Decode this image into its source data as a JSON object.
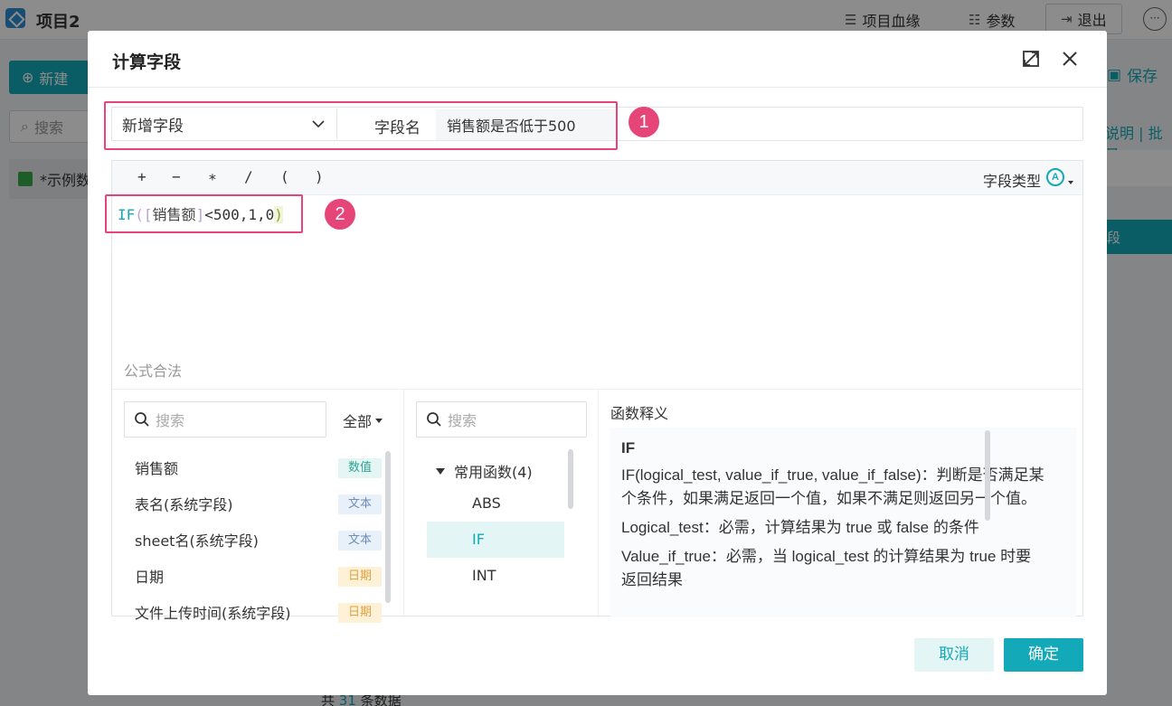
{
  "app": {
    "title": "项目2",
    "header": {
      "lineage": "项目血缘",
      "params": "参数",
      "exit": "退出",
      "more": "···"
    },
    "new_button": "新建",
    "search_placeholder": "搜索",
    "tree_item": "*示例数",
    "save": "保存",
    "desc_links": "说明 | 批量",
    "teal_item": "段",
    "footer": {
      "prefix": "共",
      "count": "31",
      "suffix": "条数据"
    }
  },
  "dialog": {
    "title": "计算字段",
    "mode_select": "新增字段",
    "field_name_label": "字段名",
    "field_name_value": "销售额是否低于500",
    "annotation_1": "1",
    "annotation_2": "2",
    "operators": [
      "+",
      "−",
      "∗",
      "/",
      "(",
      ")"
    ],
    "field_type_label": "字段类型",
    "field_type_icon": "A",
    "formula": {
      "fn": "IF",
      "open": "(",
      "field_open": "[",
      "field": "销售额",
      "field_close": "]",
      "rest": "<500,1,0",
      "close": ")"
    },
    "validation": "公式合法",
    "fields_pane": {
      "search_placeholder": "搜索",
      "filter": "全部",
      "items": [
        {
          "name": "销售额",
          "tag": "数值",
          "kind": "num"
        },
        {
          "name": "表名(系统字段)",
          "tag": "文本",
          "kind": "text"
        },
        {
          "name": "sheet名(系统字段)",
          "tag": "文本",
          "kind": "text"
        },
        {
          "name": "日期",
          "tag": "日期",
          "kind": "date"
        },
        {
          "name": "文件上传时间(系统字段)",
          "tag": "日期",
          "kind": "date"
        }
      ]
    },
    "functions_pane": {
      "search_placeholder": "搜索",
      "group": "常用函数(4)",
      "items": [
        "ABS",
        "IF",
        "INT"
      ],
      "selected": "IF"
    },
    "definition": {
      "title": "函数释义",
      "name": "IF",
      "lines": [
        "IF(logical_test, value_if_true, value_if_false)：判断是否满足某个条件，如果满足返回一个值，如果不满足则返回另一个值。",
        "Logical_test：必需，计算结果为 true 或 false 的条件",
        "Value_if_true：必需，当 logical_test 的计算结果为 true 时要返回结果"
      ]
    },
    "cancel": "取消",
    "confirm": "确定"
  },
  "colors": {
    "accent": "#13a9b8",
    "annotation": "#e6457a"
  }
}
